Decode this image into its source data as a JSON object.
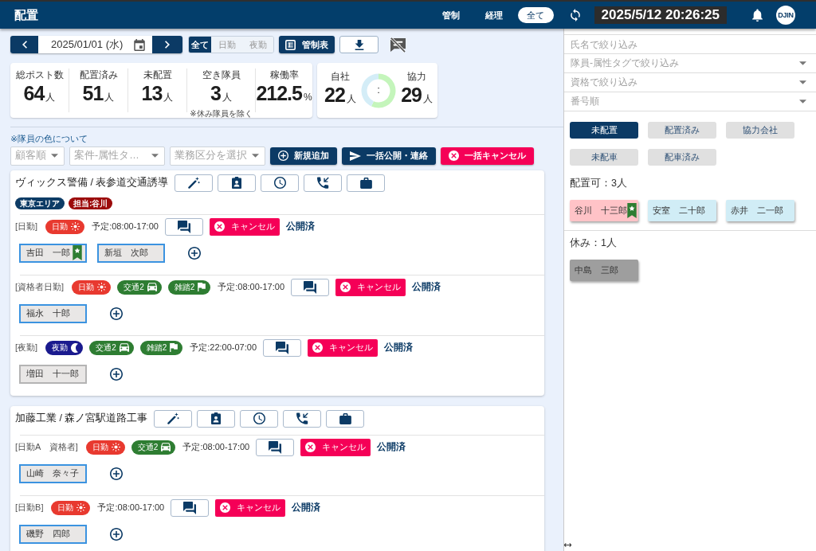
{
  "header": {
    "title": "配置",
    "nav": [
      {
        "label": "管制",
        "selected": false
      },
      {
        "label": "経理",
        "selected": false
      },
      {
        "label": "全て",
        "selected": true
      }
    ],
    "clock": "2025/5/12 20:26:25",
    "avatar": "DJIN"
  },
  "date_bar": {
    "date": "2025/01/01 (水)",
    "shift_filter": [
      {
        "label": "全て",
        "selected": true
      },
      {
        "label": "日勤",
        "selected": false
      },
      {
        "label": "夜勤",
        "selected": false
      }
    ],
    "schedule_button": "管制表"
  },
  "stats": [
    {
      "label": "総ポスト数",
      "value": "64",
      "unit": "人"
    },
    {
      "label": "配置済み",
      "value": "51",
      "unit": "人"
    },
    {
      "label": "未配置",
      "value": "13",
      "unit": "人"
    },
    {
      "label": "空き隊員",
      "value": "3",
      "unit": "人",
      "note": "※休み隊員を除く"
    },
    {
      "label": "稼働率",
      "value": "212.5",
      "unit": "%"
    }
  ],
  "ratio": {
    "own": {
      "label": "自社",
      "value": "22",
      "unit": "人"
    },
    "separator": ":",
    "partner": {
      "label": "協力",
      "value": "29",
      "unit": "人"
    }
  },
  "color_legend_link": "※隊員の色について",
  "filters": [
    {
      "placeholder": "顧客順"
    },
    {
      "placeholder": "案件-属性タ…"
    },
    {
      "placeholder": "業務区分を選択"
    }
  ],
  "actions": [
    {
      "kind": "add",
      "label": "新規追加"
    },
    {
      "kind": "publish",
      "label": "一括公開・連絡"
    },
    {
      "kind": "cancel",
      "label": "一括キャンセル"
    }
  ],
  "projects": [
    {
      "title": "ヴィックス警備 / 表参道交通誘導",
      "tags": [
        {
          "label": "東京エリア",
          "color": "#0d3c66"
        },
        {
          "label": "担当:谷川",
          "color": "#9c0b0b"
        }
      ],
      "shifts": [
        {
          "label": "[日勤]",
          "badges": [
            {
              "kind": "day",
              "label": "日勤"
            }
          ],
          "schedule": "予定:08:00-17:00",
          "cancel": "キャンセル",
          "status": "公開済",
          "staff": [
            {
              "name": "吉田　一郎",
              "highlighted": true,
              "bookmarked": true
            },
            {
              "name": "新垣　次郎",
              "highlighted": true,
              "bookmarked": false
            }
          ]
        },
        {
          "label": "[資格者日勤]",
          "badges": [
            {
              "kind": "day",
              "label": "日勤"
            },
            {
              "kind": "traffic",
              "label": "交通2"
            },
            {
              "kind": "crowd",
              "label": "雑踏2"
            }
          ],
          "schedule": "予定:08:00-17:00",
          "cancel": "キャンセル",
          "status": "公開済",
          "staff": [
            {
              "name": "福永　十郎",
              "highlighted": true,
              "bookmarked": false
            }
          ]
        },
        {
          "label": "[夜勤]",
          "badges": [
            {
              "kind": "night",
              "label": "夜勤"
            },
            {
              "kind": "traffic",
              "label": "交通2"
            },
            {
              "kind": "crowd",
              "label": "雑踏2"
            }
          ],
          "schedule": "予定:22:00-07:00",
          "cancel": "キャンセル",
          "status": "公開済",
          "staff": [
            {
              "name": "増田　十一郎",
              "highlighted": false,
              "bookmarked": false
            }
          ]
        }
      ]
    },
    {
      "title": "加藤工業 / 森ノ宮駅道路工事",
      "shifts": [
        {
          "label": "[日勤A　資格者]",
          "badges": [
            {
              "kind": "day",
              "label": "日勤"
            },
            {
              "kind": "traffic",
              "label": "交通2"
            }
          ],
          "schedule": "予定:08:00-17:00",
          "cancel": "キャンセル",
          "status": "公開済",
          "staff": [
            {
              "name": "山崎　奈々子",
              "highlighted": true,
              "bookmarked": false
            }
          ]
        },
        {
          "label": "[日勤B]",
          "badges": [
            {
              "kind": "day",
              "label": "日勤"
            }
          ],
          "schedule": "予定:08:00-17:00",
          "cancel": "キャンセル",
          "status": "公開済",
          "staff": [
            {
              "name": "磯野　四郎",
              "highlighted": true,
              "bookmarked": false
            }
          ]
        }
      ]
    }
  ],
  "side_filters": [
    {
      "kind": "text",
      "placeholder": "氏名で絞り込み"
    },
    {
      "kind": "select",
      "placeholder": "隊員-属性タグで絞り込み"
    },
    {
      "kind": "select",
      "placeholder": "資格で絞り込み"
    },
    {
      "kind": "select",
      "placeholder": "番号順"
    }
  ],
  "side_tabs": [
    {
      "label": "未配置",
      "selected": true
    },
    {
      "label": "配置済み",
      "selected": false
    },
    {
      "label": "協力会社",
      "selected": false
    },
    {
      "label": "未配車",
      "selected": false
    },
    {
      "label": "配車済み",
      "selected": false
    }
  ],
  "groups": [
    {
      "title": "配置可：3人",
      "staff": [
        {
          "name": "谷川　十三郎",
          "color": "#ffc3c7",
          "bookmarked": true
        },
        {
          "name": "安室　二十郎",
          "color": "#d1edf6",
          "bookmarked": false
        },
        {
          "name": "赤井　二一郎",
          "color": "#d1edf6",
          "bookmarked": false
        }
      ]
    },
    {
      "title": "休み：1人",
      "staff": [
        {
          "name": "中島　三郎",
          "color": "#9e9e9e",
          "bookmarked": false
        }
      ]
    }
  ]
}
